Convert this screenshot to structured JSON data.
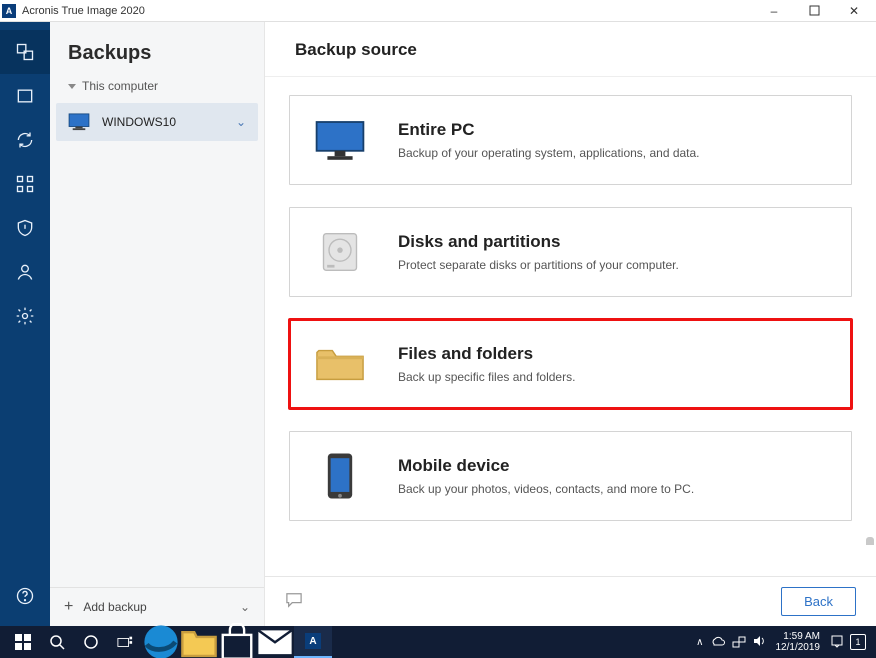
{
  "window": {
    "title": "Acronis True Image 2020",
    "app_icon_letter": "A"
  },
  "sidebar": {
    "header": "Backups",
    "group_label": "This computer",
    "items": [
      {
        "label": "WINDOWS10"
      }
    ],
    "footer_label": "Add backup"
  },
  "main": {
    "title": "Backup source",
    "back_label": "Back"
  },
  "options": [
    {
      "key": "entire-pc",
      "title": "Entire PC",
      "desc": "Backup of your operating system, applications, and data."
    },
    {
      "key": "disks",
      "title": "Disks and partitions",
      "desc": "Protect separate disks or partitions of your computer."
    },
    {
      "key": "files",
      "title": "Files and folders",
      "desc": "Back up specific files and folders.",
      "highlight": true
    },
    {
      "key": "mobile",
      "title": "Mobile device",
      "desc": "Back up your photos, videos, contacts, and more to PC."
    }
  ],
  "taskbar": {
    "time": "1:59 AM",
    "date": "12/1/2019",
    "badge": "1"
  }
}
